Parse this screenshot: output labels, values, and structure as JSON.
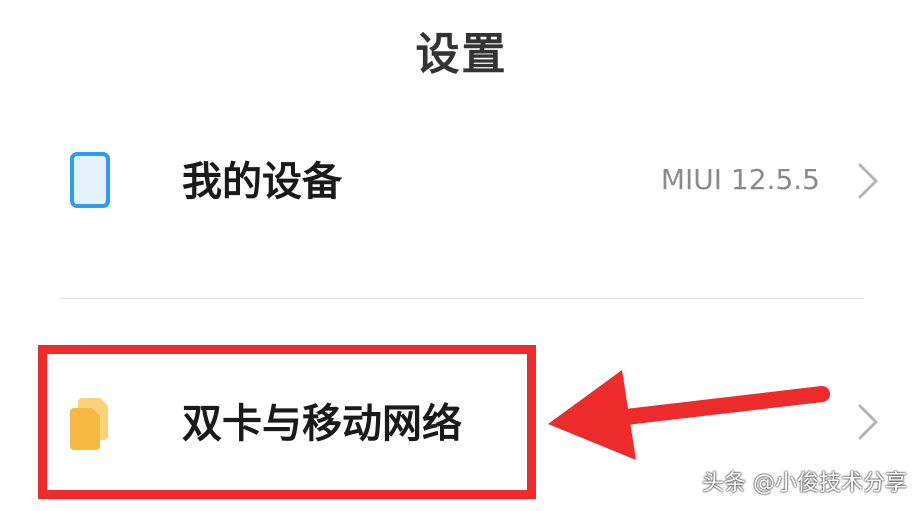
{
  "header": {
    "title": "设置"
  },
  "settings": {
    "items": [
      {
        "label": "我的设备",
        "value": "MIUI 12.5.5",
        "icon": "phone-icon",
        "icon_color": "#2e9cf0"
      },
      {
        "label": "双卡与移动网络",
        "icon": "sim-cards-icon",
        "icon_color": "#f5b840"
      }
    ]
  },
  "annotation": {
    "highlight_color": "#ee2b2b"
  },
  "watermark": {
    "text": "头条 @小俊技术分享"
  }
}
